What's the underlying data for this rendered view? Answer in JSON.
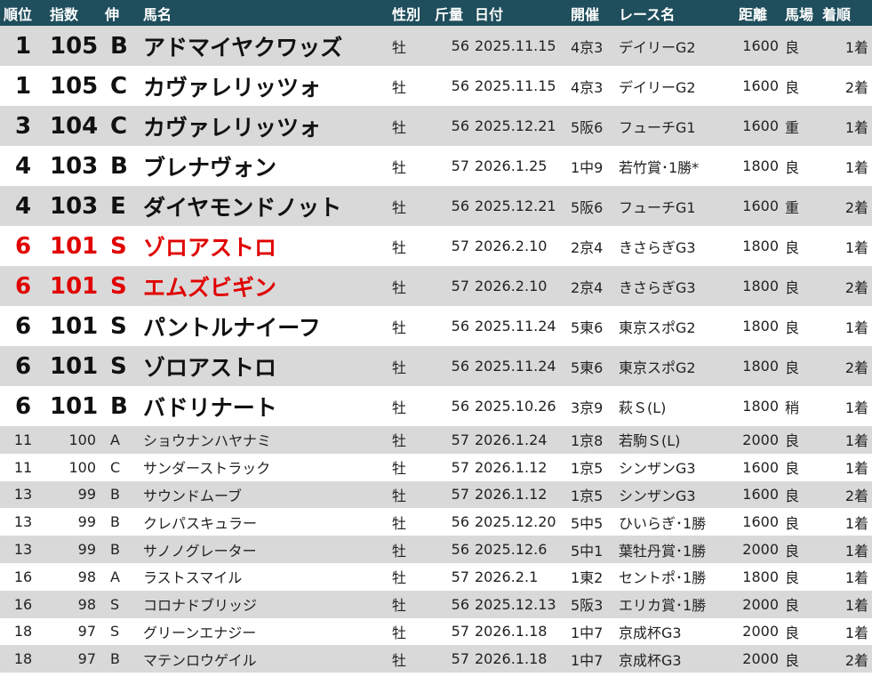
{
  "headers": [
    "順位",
    "指数",
    "伸",
    "馬名",
    "性別",
    "斤量",
    "日付",
    "開催",
    "レース名",
    "距離",
    "馬場",
    "着順"
  ],
  "rows": [
    {
      "rank": "1",
      "index": "105",
      "nobi": "B",
      "name": "アドマイヤクワッズ",
      "sex": "牡",
      "kin": "56",
      "date": "2025.11.15",
      "kaisai": "4京3",
      "race": "デイリーG2",
      "dist": "1600",
      "baba": "良",
      "chaku": "1着"
    },
    {
      "rank": "1",
      "index": "105",
      "nobi": "C",
      "name": "カヴァレリッツォ",
      "sex": "牡",
      "kin": "56",
      "date": "2025.11.15",
      "kaisai": "4京3",
      "race": "デイリーG2",
      "dist": "1600",
      "baba": "良",
      "chaku": "2着"
    },
    {
      "rank": "3",
      "index": "104",
      "nobi": "C",
      "name": "カヴァレリッツォ",
      "sex": "牡",
      "kin": "56",
      "date": "2025.12.21",
      "kaisai": "5阪6",
      "race": "フューチG1",
      "dist": "1600",
      "baba": "重",
      "chaku": "1着"
    },
    {
      "rank": "4",
      "index": "103",
      "nobi": "B",
      "name": "ブレナヴォン",
      "sex": "牡",
      "kin": "57",
      "date": "2026.1.25",
      "kaisai": "1中9",
      "race": "若竹賞･1勝*",
      "dist": "1800",
      "baba": "良",
      "chaku": "1着"
    },
    {
      "rank": "4",
      "index": "103",
      "nobi": "E",
      "name": "ダイヤモンドノット",
      "sex": "牡",
      "kin": "56",
      "date": "2025.12.21",
      "kaisai": "5阪6",
      "race": "フューチG1",
      "dist": "1600",
      "baba": "重",
      "chaku": "2着"
    },
    {
      "rank": "6",
      "index": "101",
      "nobi": "S",
      "name": "ゾロアストロ",
      "sex": "牡",
      "kin": "57",
      "date": "2026.2.10",
      "kaisai": "2京4",
      "race": "きさらぎG3",
      "dist": "1800",
      "baba": "良",
      "chaku": "1着"
    },
    {
      "rank": "6",
      "index": "101",
      "nobi": "S",
      "name": "エムズビギン",
      "sex": "牡",
      "kin": "57",
      "date": "2026.2.10",
      "kaisai": "2京4",
      "race": "きさらぎG3",
      "dist": "1800",
      "baba": "良",
      "chaku": "2着"
    },
    {
      "rank": "6",
      "index": "101",
      "nobi": "S",
      "name": "パントルナイーフ",
      "sex": "牡",
      "kin": "56",
      "date": "2025.11.24",
      "kaisai": "5東6",
      "race": "東京スポG2",
      "dist": "1800",
      "baba": "良",
      "chaku": "1着"
    },
    {
      "rank": "6",
      "index": "101",
      "nobi": "S",
      "name": "ゾロアストロ",
      "sex": "牡",
      "kin": "56",
      "date": "2025.11.24",
      "kaisai": "5東6",
      "race": "東京スポG2",
      "dist": "1800",
      "baba": "良",
      "chaku": "2着"
    },
    {
      "rank": "6",
      "index": "101",
      "nobi": "B",
      "name": "バドリナート",
      "sex": "牡",
      "kin": "56",
      "date": "2025.10.26",
      "kaisai": "3京9",
      "race": "萩Ｓ(L)",
      "dist": "1800",
      "baba": "稍",
      "chaku": "1着"
    },
    {
      "rank": "11",
      "index": "100",
      "nobi": "A",
      "name": "ショウナンハヤナミ",
      "sex": "牡",
      "kin": "57",
      "date": "2026.1.24",
      "kaisai": "1京8",
      "race": "若駒Ｓ(L)",
      "dist": "2000",
      "baba": "良",
      "chaku": "1着"
    },
    {
      "rank": "11",
      "index": "100",
      "nobi": "C",
      "name": "サンダーストラック",
      "sex": "牡",
      "kin": "57",
      "date": "2026.1.12",
      "kaisai": "1京5",
      "race": "シンザンG3",
      "dist": "1600",
      "baba": "良",
      "chaku": "1着"
    },
    {
      "rank": "13",
      "index": "99",
      "nobi": "B",
      "name": "サウンドムーブ",
      "sex": "牡",
      "kin": "57",
      "date": "2026.1.12",
      "kaisai": "1京5",
      "race": "シンザンG3",
      "dist": "1600",
      "baba": "良",
      "chaku": "2着"
    },
    {
      "rank": "13",
      "index": "99",
      "nobi": "B",
      "name": "クレパスキュラー",
      "sex": "牡",
      "kin": "56",
      "date": "2025.12.20",
      "kaisai": "5中5",
      "race": "ひいらぎ･1勝",
      "dist": "1600",
      "baba": "良",
      "chaku": "1着"
    },
    {
      "rank": "13",
      "index": "99",
      "nobi": "B",
      "name": "サノノグレーター",
      "sex": "牡",
      "kin": "56",
      "date": "2025.12.6",
      "kaisai": "5中1",
      "race": "葉牡丹賞･1勝",
      "dist": "2000",
      "baba": "良",
      "chaku": "1着"
    },
    {
      "rank": "16",
      "index": "98",
      "nobi": "A",
      "name": "ラストスマイル",
      "sex": "牡",
      "kin": "57",
      "date": "2026.2.1",
      "kaisai": "1東2",
      "race": "セントポ･1勝",
      "dist": "1800",
      "baba": "良",
      "chaku": "1着"
    },
    {
      "rank": "16",
      "index": "98",
      "nobi": "S",
      "name": "コロナドブリッジ",
      "sex": "牡",
      "kin": "56",
      "date": "2025.12.13",
      "kaisai": "5阪3",
      "race": "エリカ賞･1勝",
      "dist": "2000",
      "baba": "良",
      "chaku": "1着"
    },
    {
      "rank": "18",
      "index": "97",
      "nobi": "S",
      "name": "グリーンエナジー",
      "sex": "牡",
      "kin": "57",
      "date": "2026.1.18",
      "kaisai": "1中7",
      "race": "京成杯G3",
      "dist": "2000",
      "baba": "良",
      "chaku": "1着"
    },
    {
      "rank": "18",
      "index": "97",
      "nobi": "B",
      "name": "マテンロウゲイル",
      "sex": "牡",
      "kin": "57",
      "date": "2026.1.18",
      "kaisai": "1中7",
      "race": "京成杯G3",
      "dist": "2000",
      "baba": "良",
      "chaku": "2着"
    }
  ],
  "colors": {
    "header_bg": "#1f4e5c",
    "header_text": "#ffffff",
    "stripe": "#d9d9d9",
    "highlight": "#e00000"
  }
}
